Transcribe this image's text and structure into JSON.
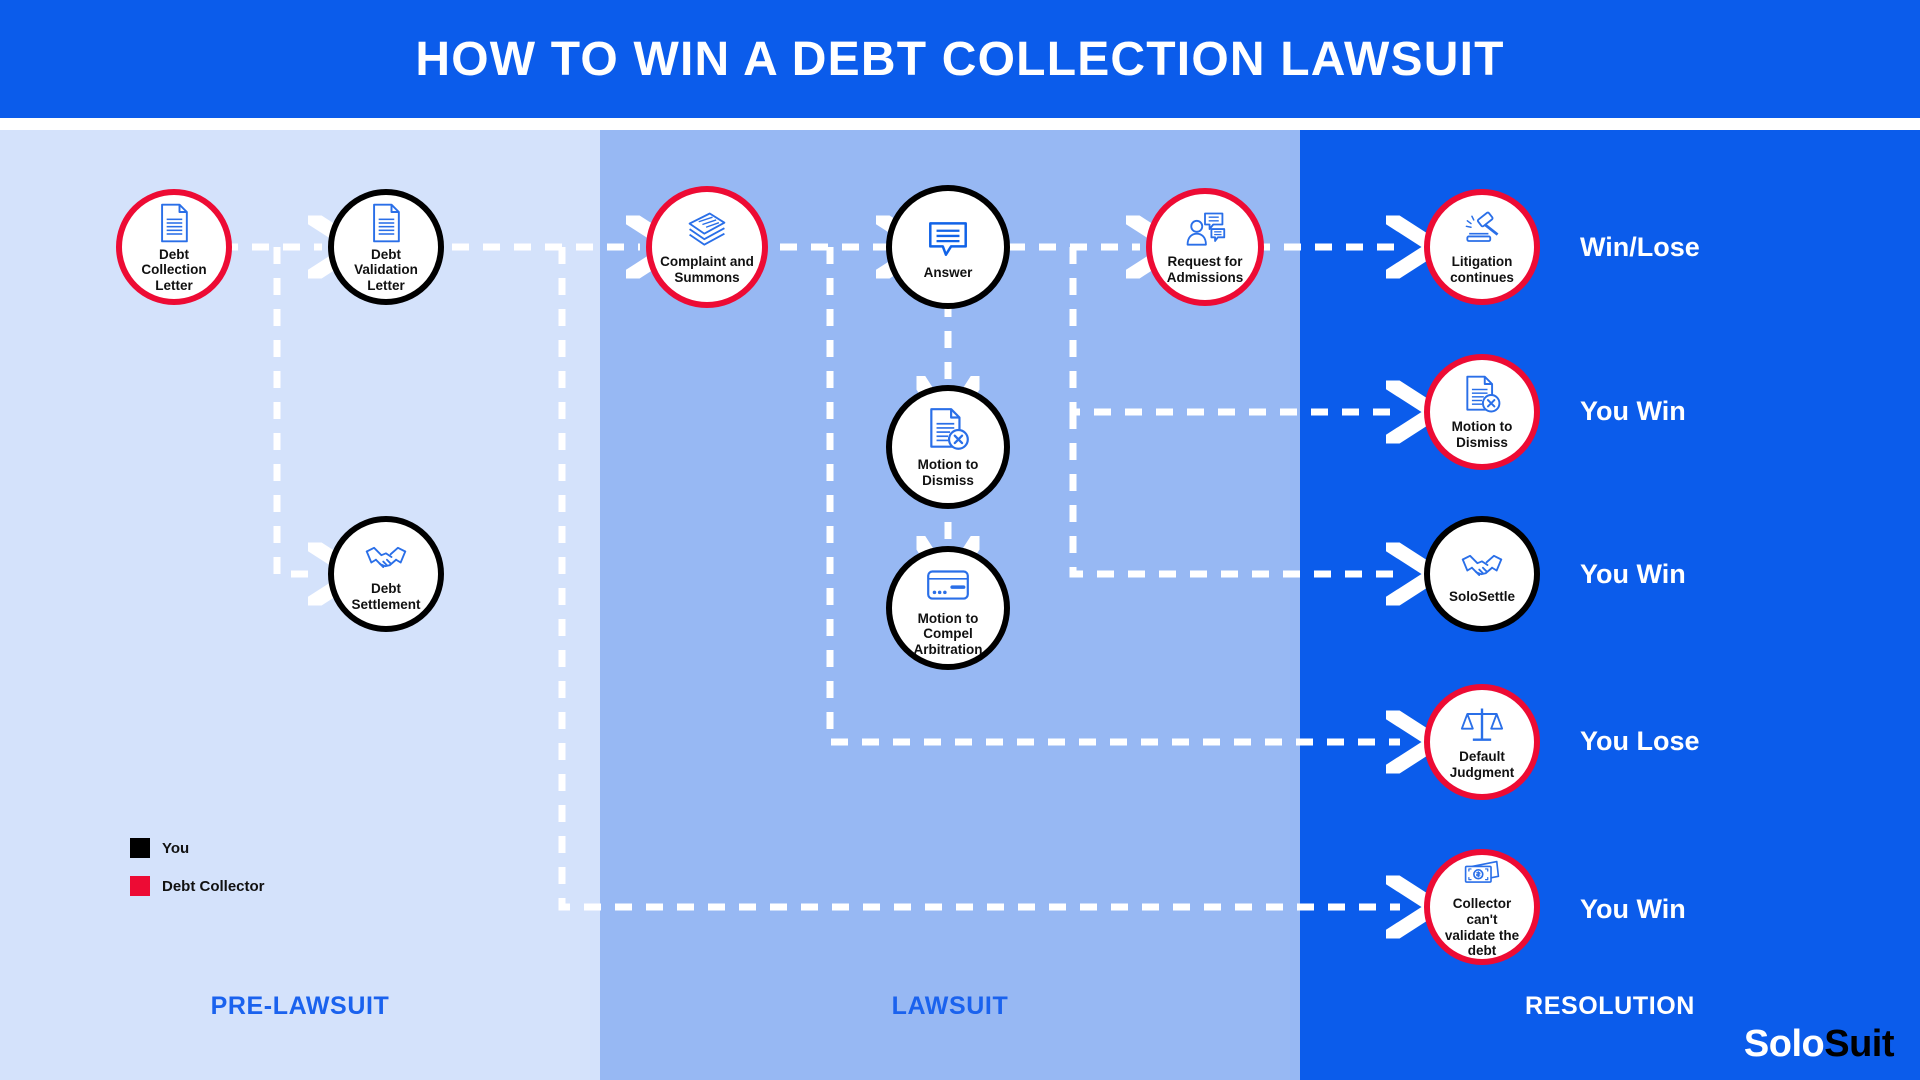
{
  "header": {
    "title": "HOW TO WIN A DEBT COLLECTION LAWSUIT"
  },
  "columns": [
    {
      "id": "pre",
      "label": "PRE-LAWSUIT",
      "color": "#D4E2FB"
    },
    {
      "id": "law",
      "label": "LAWSUIT",
      "color": "#97B8F3"
    },
    {
      "id": "res",
      "label": "RESOLUTION",
      "color": "#0B5CEB"
    }
  ],
  "colors": {
    "brand_blue": "#0B5CEB",
    "debt_collector_red": "#ED0B34",
    "you_black": "#000000",
    "icon_blue": "#2A6FE8",
    "label_blue": "#1A62EE",
    "connector_white": "#FFFFFF"
  },
  "nodes": {
    "debt_collection_letter": {
      "label": "Debt Collection\nLetter",
      "line1": "Debt Collection",
      "line2": "Letter",
      "ring": "red",
      "icon": "document-icon"
    },
    "debt_validation_letter": {
      "label": "Debt Validation\nLetter",
      "line1": "Debt Validation",
      "line2": "Letter",
      "ring": "black",
      "icon": "document-icon"
    },
    "debt_settlement": {
      "label": "Debt Settlement",
      "line1": "Debt Settlement",
      "line2": "",
      "ring": "black",
      "icon": "handshake-icon"
    },
    "complaint_and_summons": {
      "label": "Complaint and\nSummons",
      "line1": "Complaint and",
      "line2": "Summons",
      "ring": "red",
      "icon": "stacked-papers-icon"
    },
    "answer": {
      "label": "Answer",
      "line1": "Answer",
      "line2": "",
      "ring": "black",
      "icon": "speech-bubble-icon"
    },
    "motion_to_dismiss_mid": {
      "label": "Motion to\nDismiss",
      "line1": "Motion to",
      "line2": "Dismiss",
      "ring": "black",
      "icon": "document-x-icon"
    },
    "motion_to_compel": {
      "label": "Motion to\nCompel Arbitration",
      "line1": "Motion to",
      "line2": "Compel Arbitration",
      "ring": "black",
      "icon": "card-icon"
    },
    "request_for_admissions": {
      "label": "Request for\nAdmissions",
      "line1": "Request for",
      "line2": "Admissions",
      "ring": "red",
      "icon": "person-chat-icon"
    },
    "litigation_continues": {
      "label": "Litigation\ncontinues",
      "line1": "Litigation",
      "line2": "continues",
      "ring": "red",
      "icon": "gavel-icon"
    },
    "motion_to_dismiss_res": {
      "label": "Motion to\nDismiss",
      "line1": "Motion to",
      "line2": "Dismiss",
      "ring": "red",
      "icon": "document-x-icon"
    },
    "solosettle": {
      "label": "SoloSettle",
      "line1": "SoloSettle",
      "line2": "",
      "ring": "black",
      "icon": "handshake-icon"
    },
    "default_judgment": {
      "label": "Default Judgment",
      "line1": "Default Judgment",
      "line2": "",
      "ring": "red",
      "icon": "scales-icon"
    },
    "cant_validate": {
      "label": "Collector can't\nvalidate the debt",
      "line1": "Collector can't",
      "line2": "validate the debt",
      "ring": "red",
      "icon": "money-icon"
    }
  },
  "outcomes": {
    "litigation_continues": "Win/Lose",
    "motion_to_dismiss_res": "You Win",
    "solosettle": "You Win",
    "default_judgment": "You Lose",
    "cant_validate": "You Win"
  },
  "legend": [
    {
      "label": "You",
      "color": "#000000",
      "swatch": "you-swatch"
    },
    {
      "label": "Debt Collector",
      "color": "#ED0B34",
      "swatch": "debt-collector-swatch"
    }
  ],
  "brand": {
    "part1": "Solo",
    "part2": "Suit"
  }
}
